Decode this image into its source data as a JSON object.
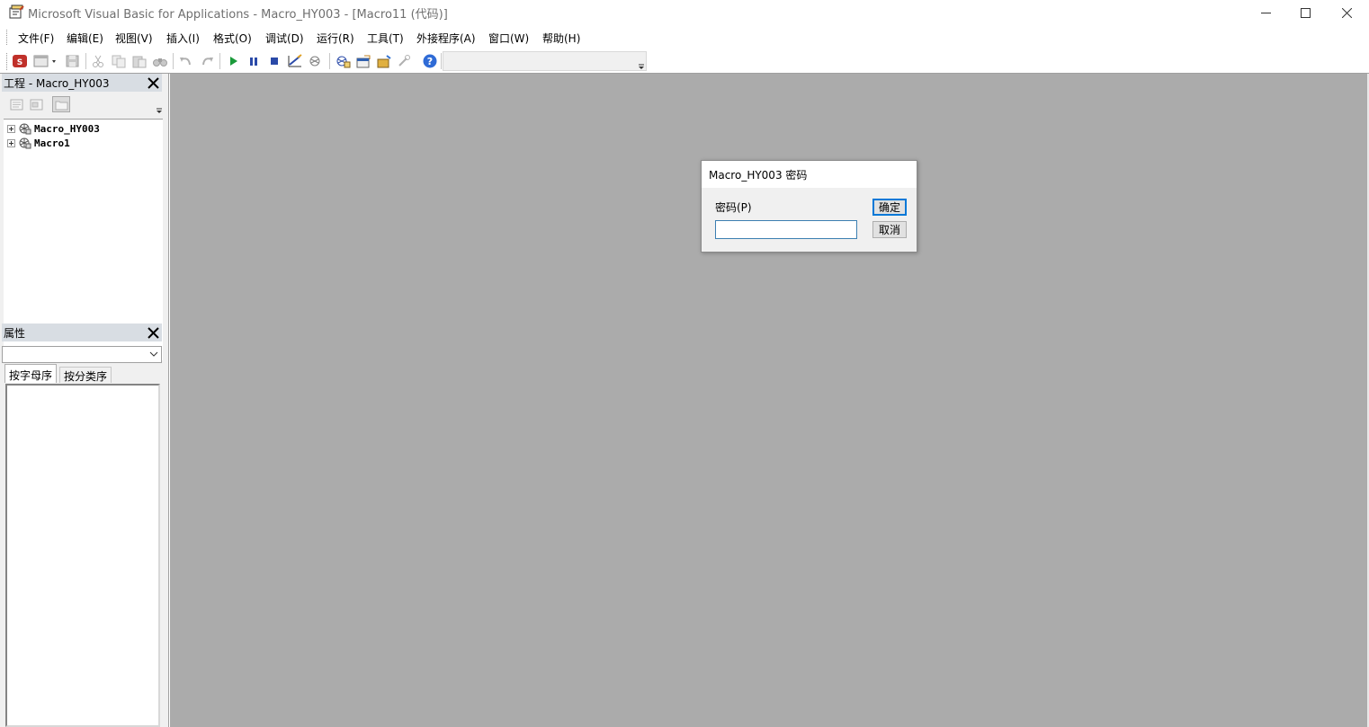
{
  "window": {
    "title": "Microsoft Visual Basic for Applications - Macro_HY003 - [Macro11 (代码)]"
  },
  "menu": [
    {
      "label": "文件(F)"
    },
    {
      "label": "编辑(E)"
    },
    {
      "label": "视图(V)"
    },
    {
      "label": "插入(I)"
    },
    {
      "label": "格式(O)"
    },
    {
      "label": "调试(D)"
    },
    {
      "label": "运行(R)"
    },
    {
      "label": "工具(T)"
    },
    {
      "label": "外接程序(A)"
    },
    {
      "label": "窗口(W)"
    },
    {
      "label": "帮助(H)"
    }
  ],
  "project_pane": {
    "title": "工程 - Macro_HY003",
    "tree": [
      {
        "label": "Macro_HY003"
      },
      {
        "label": "Macro1"
      }
    ]
  },
  "properties_pane": {
    "title": "属性",
    "tabs": [
      {
        "label": "按字母序"
      },
      {
        "label": "按分类序"
      }
    ]
  },
  "dialog": {
    "title": "Macro_HY003 密码",
    "label": "密码(P)",
    "input_value": "",
    "ok_label": "确定",
    "cancel_label": "取消"
  },
  "colors": {
    "accent": "#0078d7",
    "workspace": "#ababab",
    "pane_header": "#d8dde3"
  }
}
